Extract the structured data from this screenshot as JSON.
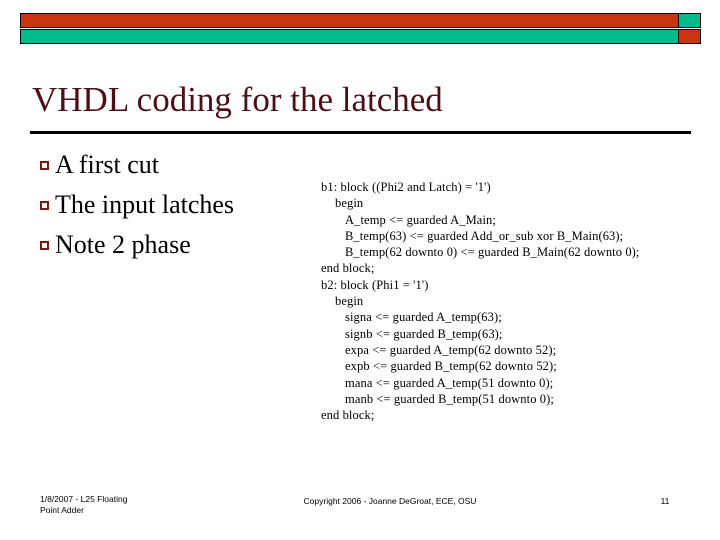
{
  "theme": {
    "accent_red": "#CC3311",
    "accent_teal": "#00BC8C",
    "title_color": "#4C0F18",
    "bullet_color": "#7B1A10",
    "body_color": "#000000",
    "background": "#FFFFFF"
  },
  "slide": {
    "title": "VHDL coding for the latched",
    "bullets": [
      {
        "marker": "hollow-square",
        "text": "A first cut"
      },
      {
        "marker": "hollow-square",
        "text": "The input latches"
      },
      {
        "marker": "hollow-square",
        "text": "Note 2 phase"
      }
    ],
    "code_lines": [
      {
        "indent": 0,
        "text": "b1: block ((Phi2 and Latch) = '1')"
      },
      {
        "indent": 1,
        "text": "begin"
      },
      {
        "indent": 2,
        "text": "A_temp <= guarded A_Main;"
      },
      {
        "indent": 2,
        "text": "B_temp(63) <= guarded Add_or_sub xor B_Main(63);"
      },
      {
        "indent": 2,
        "text": "B_temp(62 downto 0) <= guarded B_Main(62 downto 0);"
      },
      {
        "indent": 0,
        "text": "end block;"
      },
      {
        "indent": 0,
        "text": "b2: block (Phi1 = '1')"
      },
      {
        "indent": 1,
        "text": "begin"
      },
      {
        "indent": 2,
        "text": "signa <= guarded A_temp(63);"
      },
      {
        "indent": 2,
        "text": "signb <= guarded B_temp(63);"
      },
      {
        "indent": 2,
        "text": "expa <= guarded A_temp(62 downto 52);"
      },
      {
        "indent": 2,
        "text": "expb <= guarded B_temp(62 downto 52);"
      },
      {
        "indent": 2,
        "text": "mana <= guarded A_temp(51 downto 0);"
      },
      {
        "indent": 2,
        "text": "manb <= guarded B_temp(51 downto 0);"
      },
      {
        "indent": 0,
        "text": "end block;"
      }
    ]
  },
  "footer": {
    "left_line1": "1/8/2007 - L25 Floating",
    "left_line2": "Point Adder",
    "center": "Copyright 2006 - Joanne DeGroat, ECE, OSU",
    "page_number": "11"
  }
}
